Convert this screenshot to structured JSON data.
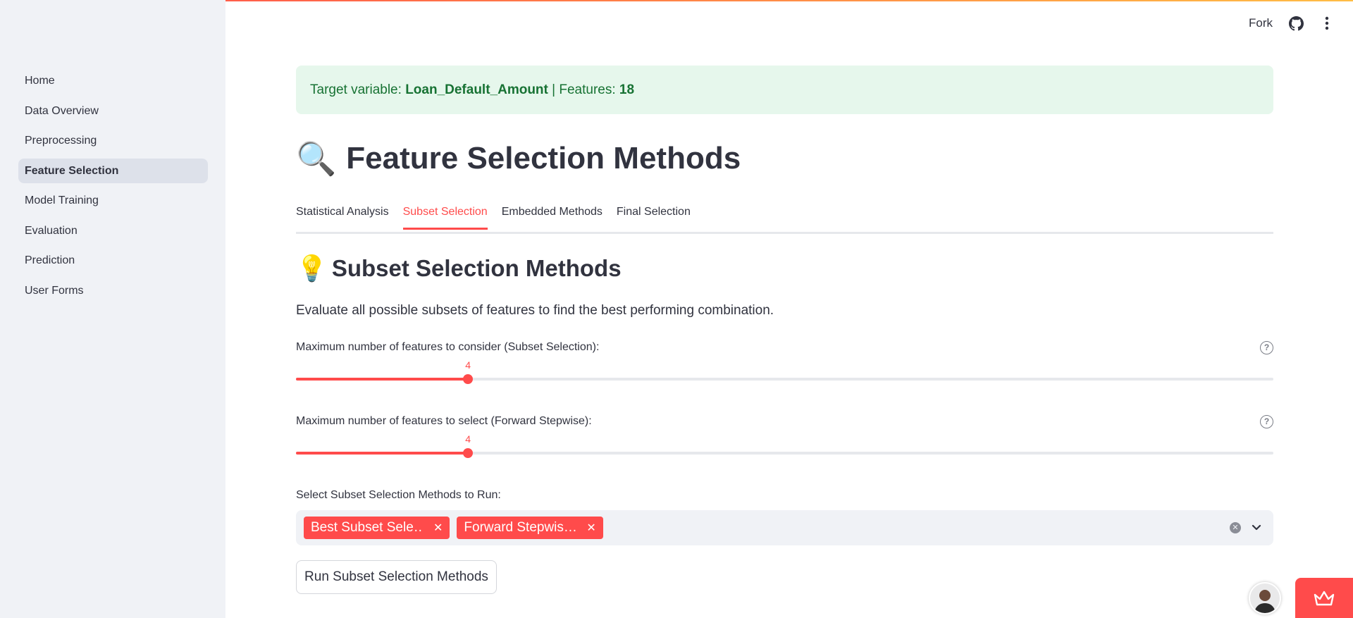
{
  "header": {
    "fork_label": "Fork",
    "github_icon": "github-icon",
    "more_icon": "more-vertical-icon"
  },
  "sidebar": {
    "items": [
      {
        "label": "Home",
        "active": false
      },
      {
        "label": "Data Overview",
        "active": false
      },
      {
        "label": "Preprocessing",
        "active": false
      },
      {
        "label": "Feature Selection",
        "active": true
      },
      {
        "label": "Model Training",
        "active": false
      },
      {
        "label": "Evaluation",
        "active": false
      },
      {
        "label": "Prediction",
        "active": false
      },
      {
        "label": "User Forms",
        "active": false
      }
    ]
  },
  "info": {
    "prefix": "Target variable: ",
    "target": "Loan_Default_Amount",
    "separator": " | Features: ",
    "features": "18"
  },
  "page": {
    "title_emoji": "🔍",
    "title": "Feature Selection Methods"
  },
  "tabs": [
    {
      "label": "Statistical Analysis",
      "active": false
    },
    {
      "label": "Subset Selection",
      "active": true
    },
    {
      "label": "Embedded Methods",
      "active": false
    },
    {
      "label": "Final Selection",
      "active": false
    }
  ],
  "section": {
    "emoji": "💡",
    "title": "Subset Selection Methods",
    "description": "Evaluate all possible subsets of features to find the best performing combination."
  },
  "sliders": [
    {
      "label": "Maximum number of features to consider (Subset Selection):",
      "value": "4",
      "fraction": 0.176
    },
    {
      "label": "Maximum number of features to select (Forward Stepwise):",
      "value": "4",
      "fraction": 0.176
    }
  ],
  "multiselect": {
    "label": "Select Subset Selection Methods to Run:",
    "chips": [
      "Best Subset Sele…",
      "Forward Stepwis…"
    ]
  },
  "run_button": "Run Subset Selection Methods",
  "colors": {
    "accent": "#ff4b4b",
    "success_bg": "#e6f7ec",
    "success_text": "#177233",
    "sidebar_bg": "#f0f2f6"
  }
}
